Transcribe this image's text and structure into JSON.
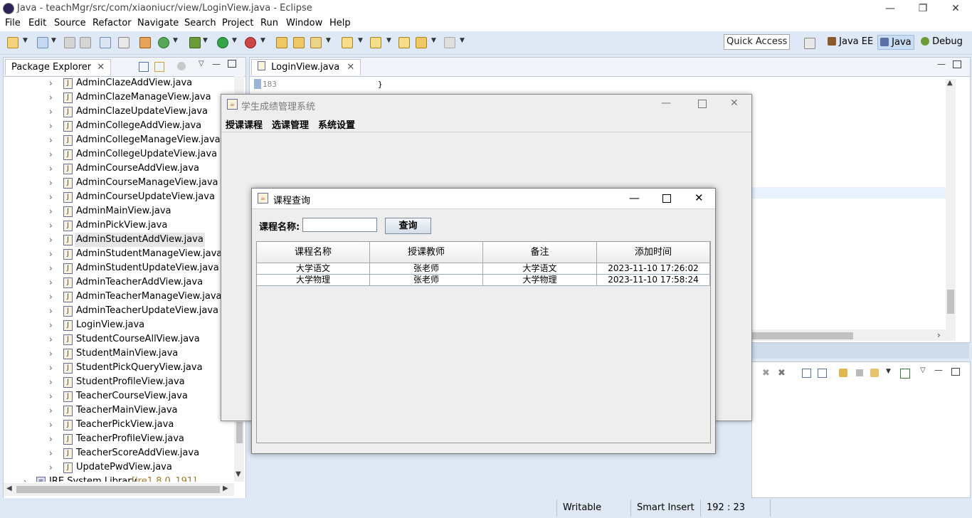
{
  "window": {
    "title": "Java - teachMgr/src/com/xiaoniucr/view/LoginView.java - Eclipse",
    "min_glyph": "—",
    "max_glyph": "❐",
    "close_glyph": "✕"
  },
  "menubar": [
    "File",
    "Edit",
    "Source",
    "Refactor",
    "Navigate",
    "Search",
    "Project",
    "Run",
    "Window",
    "Help"
  ],
  "toolbar": {
    "quick_access": "Quick Access",
    "perspectives": [
      "Java EE",
      "Java",
      "Debug"
    ]
  },
  "package_explorer": {
    "tab_label": "Package Explorer",
    "files": [
      "AdminClazeAddView.java",
      "AdminClazeManageView.java",
      "AdminClazeUpdateView.java",
      "AdminCollegeAddView.java",
      "AdminCollegeManageView.java",
      "AdminCollegeUpdateView.java",
      "AdminCourseAddView.java",
      "AdminCourseManageView.java",
      "AdminCourseUpdateView.java",
      "AdminMainView.java",
      "AdminPickView.java",
      "AdminStudentAddView.java",
      "AdminStudentManageView.java",
      "AdminStudentUpdateView.java",
      "AdminTeacherAddView.java",
      "AdminTeacherManageView.java",
      "AdminTeacherUpdateView.java",
      "LoginView.java",
      "StudentCourseAllView.java",
      "StudentMainView.java",
      "StudentPickQueryView.java",
      "StudentProfileView.java",
      "TeacherCourseView.java",
      "TeacherMainView.java",
      "TeacherPickView.java",
      "TeacherProfileView.java",
      "TeacherScoreAddView.java",
      "UpdatePwdView.java"
    ],
    "selected_file": "AdminStudentAddView.java",
    "jre_label": "JRE System Library",
    "jre_version": "[jre1.8.0_191]"
  },
  "editor": {
    "tab_label": "LoginView.java",
    "line_number": "183",
    "line_code": "}"
  },
  "main_frame": {
    "title": "学生成绩管理系统",
    "menus": [
      "授课课程",
      "选课管理",
      "系统设置"
    ]
  },
  "course_frame": {
    "title": "课程查询",
    "search_label": "课程名称:",
    "search_value": "",
    "search_button": "查询",
    "columns": [
      "课程名称",
      "授课教师",
      "备注",
      "添加时间"
    ],
    "rows": [
      [
        "大学语文",
        "张老师",
        "大学语文",
        "2023-11-10 17:26:02"
      ],
      [
        "大学物理",
        "张老师",
        "大学物理",
        "2023-11-10 17:58:24"
      ]
    ]
  },
  "statusbar": {
    "writable": "Writable",
    "insert_mode": "Smart Insert",
    "position": "192 : 23"
  }
}
